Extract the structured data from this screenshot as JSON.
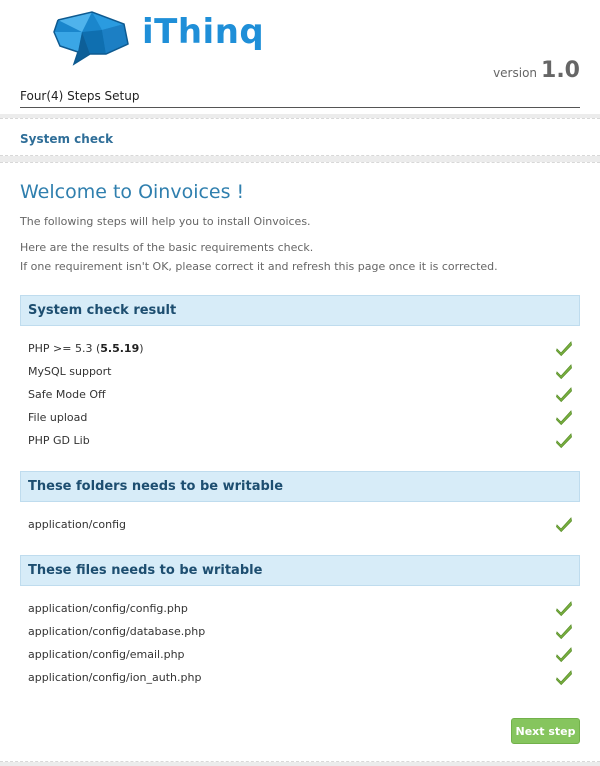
{
  "header": {
    "logo_text": "iThinq",
    "version_label": "version",
    "version_number": "1.0",
    "steps_title": "Four(4) Steps Setup"
  },
  "bar": {
    "title": "System check"
  },
  "main": {
    "welcome_title": "Welcome to Oinvoices !",
    "intro": "The following steps will help you to install Oinvoices.",
    "note_line1": "Here are the results of the basic requirements check.",
    "note_line2": "If one requirement isn't OK, please correct it and refresh this page once it is corrected.",
    "system_check": {
      "title": "System check result",
      "items": [
        {
          "label_prefix": "PHP >= 5.3 (",
          "label_bold": "5.5.19",
          "label_suffix": ")",
          "status": "ok"
        },
        {
          "label": "MySQL support",
          "status": "ok"
        },
        {
          "label": "Safe Mode Off",
          "status": "ok"
        },
        {
          "label": "File upload",
          "status": "ok"
        },
        {
          "label": "PHP GD Lib",
          "status": "ok"
        }
      ]
    },
    "folders": {
      "title": "These folders needs to be writable",
      "items": [
        {
          "label": "application/config",
          "status": "ok"
        }
      ]
    },
    "files": {
      "title": "These files needs to be writable",
      "items": [
        {
          "label": "application/config/config.php",
          "status": "ok"
        },
        {
          "label": "application/config/database.php",
          "status": "ok"
        },
        {
          "label": "application/config/email.php",
          "status": "ok"
        },
        {
          "label": "application/config/ion_auth.php",
          "status": "ok"
        }
      ]
    },
    "next_button": "Next step"
  },
  "colors": {
    "brand": "#1f8fd8",
    "section_bg": "#d7ecf8",
    "ok_green": "#7cb342",
    "button_green": "#86c55e"
  },
  "icons": {
    "status_ok": "checkmark-icon",
    "logo": "speech-bubble-logo-icon"
  }
}
